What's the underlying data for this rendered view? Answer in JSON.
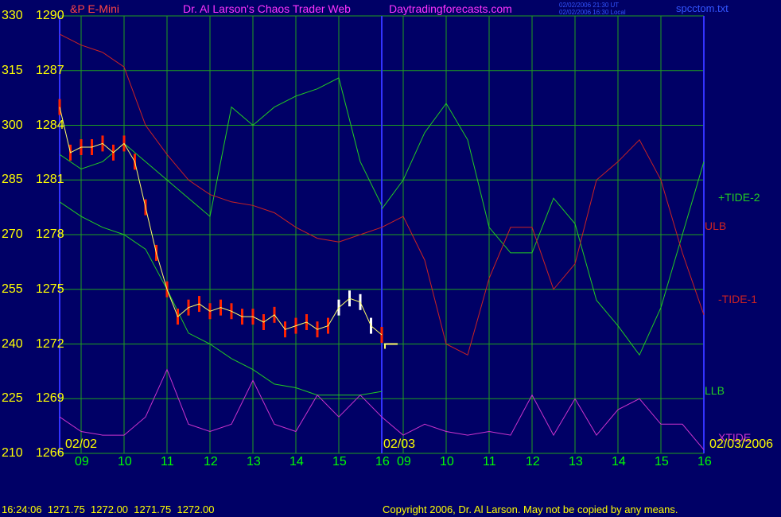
{
  "header": {
    "symbol": "&P E-Mini",
    "title": "Dr. Al Larson's Chaos Trader Web",
    "site": "Daytradingforecasts.com",
    "time_ut": "02/02/2006 21:30 UT",
    "time_local": "02/02/2006 16:30 Local",
    "filename": "spcctom.txt"
  },
  "footer": {
    "quote": "16:24:06  1271.75  1272.00  1271.75  1272.00",
    "copyright": "Copyright 2006, Dr. Al Larson. May not be copied by any means."
  },
  "colors": {
    "background": "#000066",
    "grid": "#1fa01f",
    "frame": "#3333ff",
    "axis_text": "#ffff00",
    "hour_text": "#00ff00",
    "date_text": "#ffff00",
    "tide_plus": "#22cc22",
    "tide_minus": "#cc2222",
    "xtide": "#cc33cc",
    "price_bar": "#ff2200",
    "price_bar_recent": "#ffffff",
    "moving_avg": "#ffff66",
    "trend": "#2222dd",
    "title": "#ff33ff",
    "symbol": "#ff4444"
  },
  "chart_data": {
    "type": "line",
    "y_left_ticks": [
      "330",
      "315",
      "300",
      "285",
      "270",
      "255",
      "240",
      "225",
      "210"
    ],
    "y_right_ticks": [
      "1290",
      "1287",
      "1284",
      "1281",
      "1278",
      "1275",
      "1272",
      "1269",
      "1266"
    ],
    "ylim_left": [
      210,
      330
    ],
    "ylim_price": [
      1266,
      1290
    ],
    "x_hour_labels": [
      "09",
      "10",
      "11",
      "12",
      "13",
      "14",
      "15",
      "16",
      "09",
      "10",
      "11",
      "12",
      "13",
      "14",
      "15",
      "16"
    ],
    "x_date_labels": [
      "02/02",
      "02/03",
      "02/03/2006"
    ],
    "xlim_hours": [
      8.5,
      16.0
    ],
    "sessions": [
      "02/02",
      "02/03"
    ],
    "grid": true,
    "current_price": 1272.0,
    "series": [
      {
        "name": "+TIDE-2",
        "session": "02/03",
        "points": [
          [
            8.5,
            277
          ],
          [
            9.0,
            285
          ],
          [
            9.5,
            298
          ],
          [
            10.0,
            306
          ],
          [
            10.5,
            296
          ],
          [
            11.0,
            272
          ],
          [
            11.5,
            265
          ],
          [
            12.0,
            265
          ],
          [
            12.5,
            280
          ],
          [
            13.0,
            273
          ],
          [
            13.5,
            252
          ],
          [
            14.0,
            245
          ],
          [
            14.5,
            237
          ],
          [
            15.0,
            250
          ],
          [
            15.5,
            270
          ],
          [
            16.0,
            290
          ]
        ]
      },
      {
        "session": "02/02",
        "points": [
          [
            8.5,
            292
          ],
          [
            9.0,
            288
          ],
          [
            9.5,
            290
          ],
          [
            10.0,
            295
          ],
          [
            10.5,
            290
          ],
          [
            11.0,
            285
          ],
          [
            11.5,
            280
          ],
          [
            12.0,
            275
          ],
          [
            12.5,
            305
          ],
          [
            13.0,
            300
          ],
          [
            13.5,
            305
          ],
          [
            14.0,
            308
          ],
          [
            14.5,
            310
          ],
          [
            15.0,
            313
          ],
          [
            15.5,
            290
          ],
          [
            16.0,
            278
          ]
        ]
      },
      {
        "name": "-TIDE-1",
        "session": "02/03",
        "points": [
          [
            8.5,
            272
          ],
          [
            9.0,
            275
          ],
          [
            9.5,
            263
          ],
          [
            10.0,
            240
          ],
          [
            10.5,
            237
          ],
          [
            11.0,
            258
          ],
          [
            11.5,
            272
          ],
          [
            12.0,
            272
          ],
          [
            12.5,
            255
          ],
          [
            13.0,
            262
          ],
          [
            13.5,
            285
          ],
          [
            14.0,
            290
          ],
          [
            14.5,
            296
          ],
          [
            15.0,
            285
          ],
          [
            15.5,
            265
          ],
          [
            16.0,
            248
          ]
        ]
      },
      {
        "session": "02/02",
        "points": [
          [
            8.5,
            325
          ],
          [
            9.0,
            322
          ],
          [
            9.5,
            320
          ],
          [
            10.0,
            316
          ],
          [
            10.5,
            300
          ],
          [
            11.0,
            292
          ],
          [
            11.5,
            285
          ],
          [
            12.0,
            281
          ],
          [
            12.5,
            279
          ],
          [
            13.0,
            278
          ],
          [
            13.5,
            276
          ],
          [
            14.0,
            272
          ],
          [
            14.5,
            269
          ],
          [
            15.0,
            268
          ],
          [
            15.5,
            270
          ],
          [
            16.0,
            272
          ]
        ]
      },
      {
        "name": "LLB",
        "session": "02/02",
        "points": [
          [
            8.5,
            279
          ],
          [
            9.0,
            275
          ],
          [
            9.5,
            272
          ],
          [
            10.0,
            270
          ],
          [
            10.5,
            266
          ],
          [
            11.0,
            255
          ],
          [
            11.5,
            243
          ],
          [
            12.0,
            240
          ],
          [
            12.5,
            236
          ],
          [
            13.0,
            233
          ],
          [
            13.5,
            229
          ],
          [
            14.0,
            228
          ],
          [
            14.5,
            226
          ],
          [
            15.0,
            226
          ],
          [
            15.5,
            226
          ],
          [
            16.0,
            227
          ]
        ]
      },
      {
        "name": "XTIDE",
        "session": "02/02",
        "points": [
          [
            8.5,
            220
          ],
          [
            9.0,
            216
          ],
          [
            9.5,
            215
          ],
          [
            10.0,
            215
          ],
          [
            10.5,
            220
          ],
          [
            11.0,
            233
          ],
          [
            11.5,
            218
          ],
          [
            12.0,
            216
          ],
          [
            12.5,
            218
          ],
          [
            13.0,
            230
          ],
          [
            13.5,
            218
          ],
          [
            14.0,
            216
          ],
          [
            14.5,
            226
          ],
          [
            15.0,
            220
          ],
          [
            15.5,
            226
          ],
          [
            16.0,
            220
          ]
        ]
      },
      {
        "session": "02/03",
        "points": [
          [
            8.5,
            220
          ],
          [
            9.0,
            215
          ],
          [
            9.5,
            218
          ],
          [
            10.0,
            216
          ],
          [
            10.5,
            215
          ],
          [
            11.0,
            216
          ],
          [
            11.5,
            215
          ],
          [
            12.0,
            226
          ],
          [
            12.5,
            215
          ],
          [
            13.0,
            225
          ],
          [
            13.5,
            215
          ],
          [
            14.0,
            222
          ],
          [
            14.5,
            225
          ],
          [
            15.0,
            218
          ],
          [
            15.5,
            218
          ],
          [
            16.0,
            211
          ]
        ]
      }
    ],
    "price_close": [
      [
        8.5,
        1285.0
      ],
      [
        8.75,
        1282.5
      ],
      [
        9.0,
        1282.8
      ],
      [
        9.25,
        1282.8
      ],
      [
        9.5,
        1283.0
      ],
      [
        9.75,
        1282.5
      ],
      [
        10.0,
        1283.0
      ],
      [
        10.25,
        1282.0
      ],
      [
        10.5,
        1279.5
      ],
      [
        10.75,
        1277.0
      ],
      [
        11.0,
        1275.0
      ],
      [
        11.25,
        1273.5
      ],
      [
        11.5,
        1274.0
      ],
      [
        11.75,
        1274.2
      ],
      [
        12.0,
        1273.8
      ],
      [
        12.25,
        1274.0
      ],
      [
        12.5,
        1273.8
      ],
      [
        12.75,
        1273.5
      ],
      [
        13.0,
        1273.5
      ],
      [
        13.25,
        1273.2
      ],
      [
        13.5,
        1273.6
      ],
      [
        13.75,
        1272.8
      ],
      [
        14.0,
        1273.0
      ],
      [
        14.25,
        1273.2
      ],
      [
        14.5,
        1272.8
      ],
      [
        14.75,
        1273.0
      ],
      [
        15.0,
        1274.0
      ],
      [
        15.25,
        1274.5
      ],
      [
        15.5,
        1274.3
      ],
      [
        15.75,
        1273.0
      ],
      [
        16.0,
        1272.5
      ]
    ]
  },
  "series_labels": {
    "tide_plus": "+TIDE-2",
    "ulb": "ULB",
    "tide_minus": "-TIDE-1",
    "llb": "LLB",
    "xtide": "XTIDE"
  }
}
